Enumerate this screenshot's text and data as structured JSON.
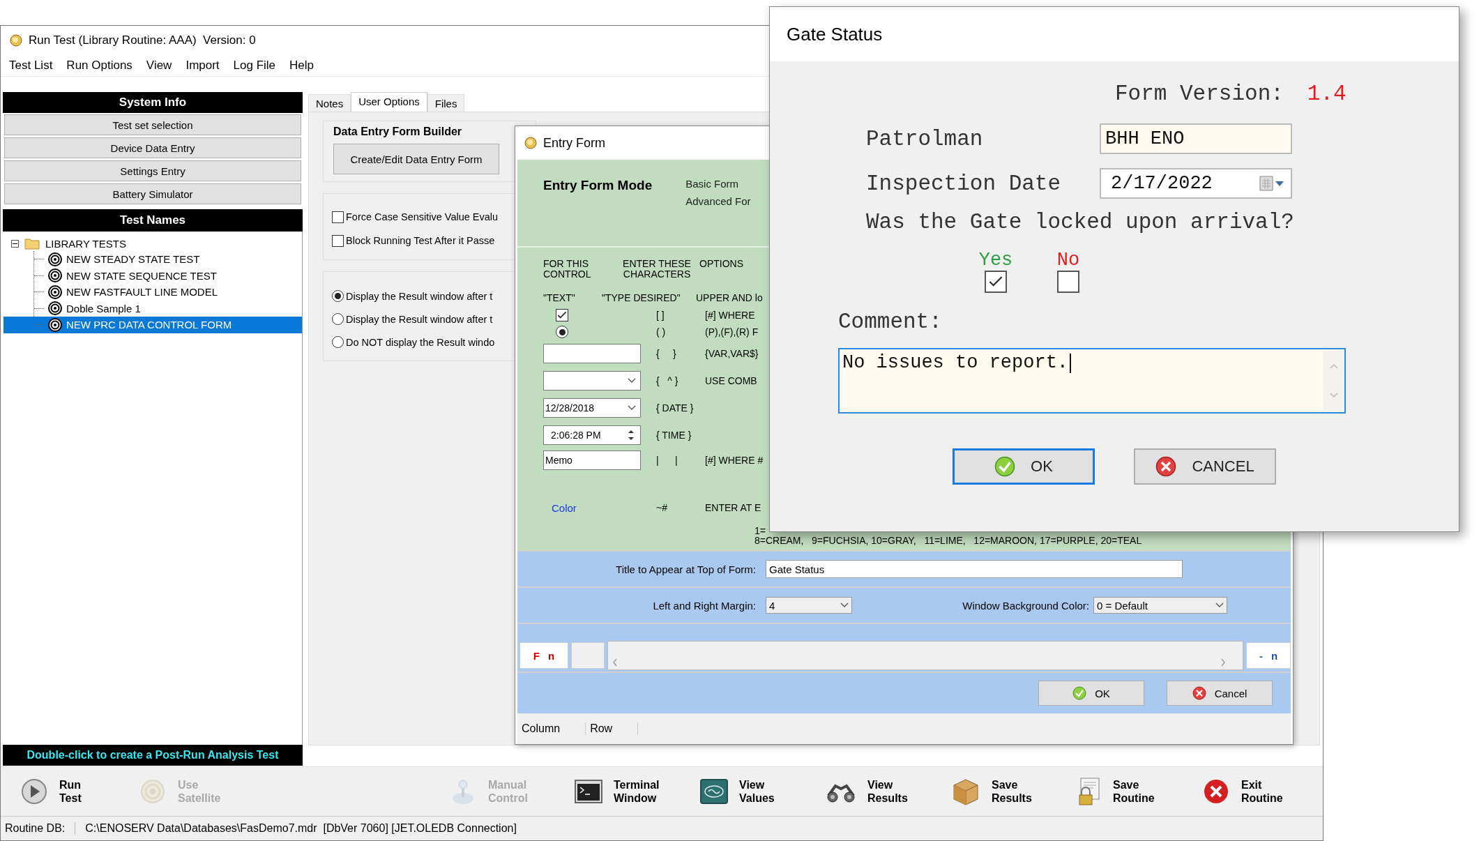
{
  "main_window": {
    "title": "Run Test (Library Routine: AAA)  Version: 0",
    "menu": [
      "Test List",
      "Run Options",
      "View",
      "Import",
      "Log File",
      "Help"
    ],
    "system_info": {
      "header": "System Info",
      "buttons": [
        "Test set selection",
        "Device Data Entry",
        "Settings Entry",
        "Battery Simulator"
      ]
    },
    "test_names": {
      "header": "Test Names",
      "tree": [
        {
          "label": "LIBRARY TESTS",
          "expanded": true,
          "children": [
            {
              "label": "NEW STEADY STATE TEST",
              "selected": false
            },
            {
              "label": "NEW STATE SEQUENCE TEST",
              "selected": false
            },
            {
              "label": "NEW FASTFAULT LINE MODEL",
              "selected": false
            },
            {
              "label": "Doble Sample 1",
              "selected": false
            },
            {
              "label": "NEW PRC DATA CONTROL FORM",
              "selected": true
            }
          ]
        }
      ]
    },
    "hint_bar": "Double-click to create a Post-Run Analysis Test",
    "tabs": [
      {
        "label": "Notes",
        "selected": false
      },
      {
        "label": "User Options",
        "selected": true
      },
      {
        "label": "Files",
        "selected": false
      }
    ],
    "user_options": {
      "group_title": "Data Entry Form Builder",
      "button": "Create/Edit Data Entry Form",
      "checkboxes": [
        {
          "label": "Force Case Sensitive Value Evalu",
          "checked": false
        },
        {
          "label": "Block Running Test After it Passe",
          "checked": false
        }
      ],
      "radios": [
        {
          "label": "Display the Result window after t",
          "selected": true
        },
        {
          "label": "Display the Result window after t",
          "selected": false
        },
        {
          "label": "Do NOT display the Result windo",
          "selected": false
        }
      ]
    },
    "toolbar": {
      "left": [
        {
          "kind": "play",
          "line1": "Run",
          "line2": "Test",
          "disabled": false
        },
        {
          "kind": "satellite",
          "line1": "Use",
          "line2": "Satellite",
          "disabled": true
        }
      ],
      "right": [
        {
          "kind": "joystick",
          "line1": "Manual",
          "line2": "Control",
          "disabled": true
        },
        {
          "kind": "terminal",
          "line1": "Terminal",
          "line2": "Window",
          "disabled": false
        },
        {
          "kind": "board",
          "line1": "View",
          "line2": "Values",
          "disabled": false
        },
        {
          "kind": "binoculars",
          "line1": "View",
          "line2": "Results",
          "disabled": false
        },
        {
          "kind": "box",
          "line1": "Save",
          "line2": "Results",
          "disabled": false
        },
        {
          "kind": "lockdoc",
          "line1": "Save",
          "line2": "Routine",
          "disabled": false
        },
        {
          "kind": "exit",
          "line1": "Exit",
          "line2": "Routine",
          "disabled": false
        }
      ]
    },
    "status_bar": {
      "label": "Routine DB:",
      "value": "C:\\ENOSERV Data\\Databases\\FasDemo7.mdr  [DbVer 7060] [JET.OLEDB Connection]"
    }
  },
  "entry_form": {
    "title": "Entry Form",
    "mode_label": "Entry Form Mode",
    "modes": [
      "Basic Form",
      "Advanced For"
    ],
    "headers": [
      "FOR THIS\nCONTROL",
      "ENTER THESE\nCHARACTERS",
      "OPTIONS"
    ],
    "subheaders": [
      "\"TEXT\"",
      "\"TYPE DESIRED\"",
      "UPPER AND lo"
    ],
    "rows": [
      {
        "kind": "checkbox",
        "checked": true,
        "chars": "[ ]",
        "option": "[#] WHERE"
      },
      {
        "kind": "radio",
        "selected": true,
        "chars": "( )",
        "option": "(P),(F),(R) F"
      },
      {
        "kind": "text",
        "chars": "{     }",
        "option": "{VAR,VAR$}"
      },
      {
        "kind": "combo",
        "chars": "{   ^ }",
        "option": "USE COMB"
      },
      {
        "kind": "date",
        "value": "12/28/2018",
        "chars": "{ DATE }"
      },
      {
        "kind": "time",
        "value": "2:06:28 PM",
        "chars": "{ TIME }"
      },
      {
        "kind": "memo",
        "value": "Memo",
        "chars": "|      |",
        "option": "[#] WHERE #"
      },
      {
        "kind": "link",
        "value": "Color",
        "chars": "~#",
        "option": "ENTER AT E"
      }
    ],
    "color_lines": [
      "1=",
      "8=CREAM,   9=FUCHSIA, 10=GRAY,   11=LIME,   12=MAROON, 17=PURPLE, 20=TEAL"
    ],
    "title_field": {
      "label": "Title to Appear at Top of Form:",
      "value": "Gate Status"
    },
    "margin": {
      "label": "Left and Right Margin:",
      "value": "4"
    },
    "bg_color": {
      "label": "Window Background Color:",
      "value": "0 = Default"
    },
    "left_marks": [
      {
        "text": "F",
        "color": "#e00000"
      },
      {
        "text": "n",
        "color": "#c00000"
      }
    ],
    "right_marks": [
      {
        "text": "-",
        "color": "#3060c0"
      },
      {
        "text": "n",
        "color": "#2050b0"
      }
    ],
    "buttons": [
      {
        "kind": "ok",
        "label": "OK"
      },
      {
        "kind": "cancel",
        "label": "Cancel"
      }
    ],
    "status": [
      "Column",
      "Row"
    ]
  },
  "gate_status": {
    "title": "Gate Status",
    "version_label": "Form Version:",
    "version": "1.4",
    "fields": [
      {
        "kind": "text",
        "label": "Patrolman",
        "value": "BHH ENO"
      },
      {
        "kind": "date",
        "label": "Inspection Date",
        "value": "2/17/2022"
      }
    ],
    "question": "Was the Gate locked upon arrival?",
    "choices": [
      {
        "label": "Yes",
        "checked": true,
        "color": "#2ea043"
      },
      {
        "label": "No",
        "checked": false,
        "color": "#e02020"
      }
    ],
    "comment_label": "Comment:",
    "comment": "No issues to report.",
    "buttons": [
      {
        "kind": "ok",
        "label": "OK",
        "default": true
      },
      {
        "kind": "cancel",
        "label": "CANCEL",
        "default": false
      }
    ]
  }
}
